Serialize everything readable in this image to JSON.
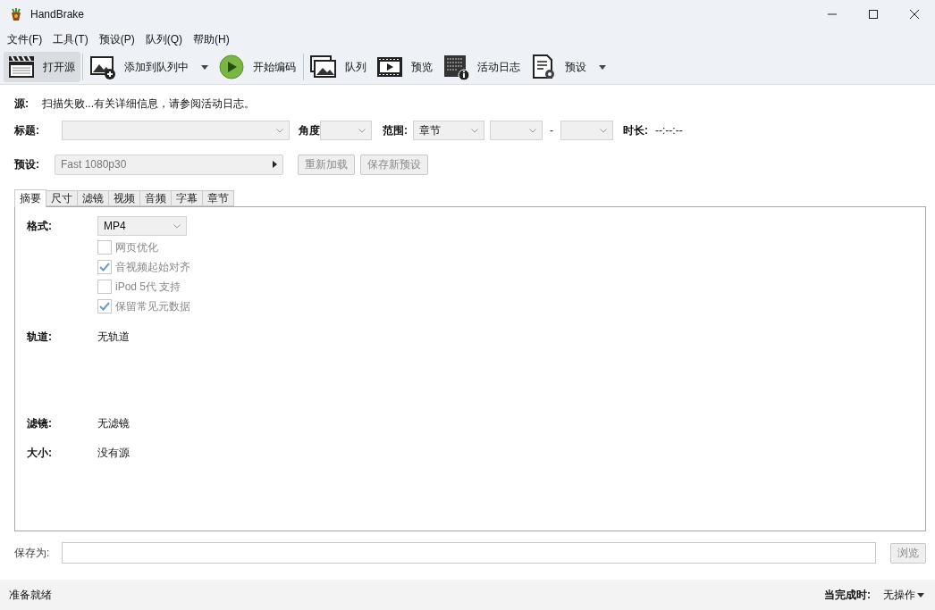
{
  "window": {
    "title": "HandBrake"
  },
  "menu": [
    "文件(F)",
    "工具(T)",
    "预设(P)",
    "队列(Q)",
    "帮助(H)"
  ],
  "toolbar": [
    {
      "kind": "clapper",
      "label": "打开源",
      "pressed": true,
      "dropdown": false
    },
    {
      "kind": "add-image",
      "label": "添加到队列中",
      "pressed": false,
      "dropdown": true
    },
    {
      "kind": "play",
      "label": "开始编码",
      "pressed": false,
      "dropdown": false
    },
    {
      "kind": "images",
      "label": "队列",
      "pressed": false,
      "dropdown": false
    },
    {
      "kind": "film",
      "label": "预览",
      "pressed": false,
      "dropdown": false
    },
    {
      "kind": "log",
      "label": "活动日志",
      "pressed": false,
      "dropdown": false
    },
    {
      "kind": "preset",
      "label": "预设",
      "pressed": false,
      "dropdown": true
    }
  ],
  "source": {
    "label": "源:",
    "text": "扫描失败...有关详细信息，请参阅活动日志。"
  },
  "title_row": {
    "title_label": "标题:",
    "angle_label": "角度",
    "range_label": "范围:",
    "range_value": "章节",
    "range_separator": "-",
    "duration_label": "时长:",
    "duration_value": "--:--:--"
  },
  "preset_row": {
    "label": "预设:",
    "value": "Fast 1080p30",
    "buttons": [
      {
        "label": "重新加载",
        "disabled": true
      },
      {
        "label": "保存新预设",
        "disabled": true
      }
    ]
  },
  "tabs": [
    {
      "label": "摘要",
      "selected": true
    },
    {
      "label": "尺寸",
      "selected": false
    },
    {
      "label": "滤镜",
      "selected": false
    },
    {
      "label": "视频",
      "selected": false
    },
    {
      "label": "音频",
      "selected": false
    },
    {
      "label": "字幕",
      "selected": false
    },
    {
      "label": "章节",
      "selected": false
    }
  ],
  "summary": {
    "format_label": "格式:",
    "format_value": "MP4",
    "options": [
      {
        "label": "网页优化",
        "checked": false,
        "disabled": true
      },
      {
        "label": "音视频起始对齐",
        "checked": true,
        "disabled": true
      },
      {
        "label": "iPod 5代 支持",
        "checked": false,
        "disabled": true
      },
      {
        "label": "保留常见元数据",
        "checked": true,
        "disabled": true
      }
    ],
    "tracks_label": "轨道:",
    "tracks_value": "无轨道",
    "filters_label": "滤镜:",
    "filters_value": "无滤镜",
    "size_label": "大小:",
    "size_value": "没有源"
  },
  "save": {
    "label": "保存为:",
    "button": "浏览"
  },
  "status_bar": {
    "status": "准备就绪",
    "when_done_label": "当完成时:",
    "when_done_value": "无操作"
  }
}
